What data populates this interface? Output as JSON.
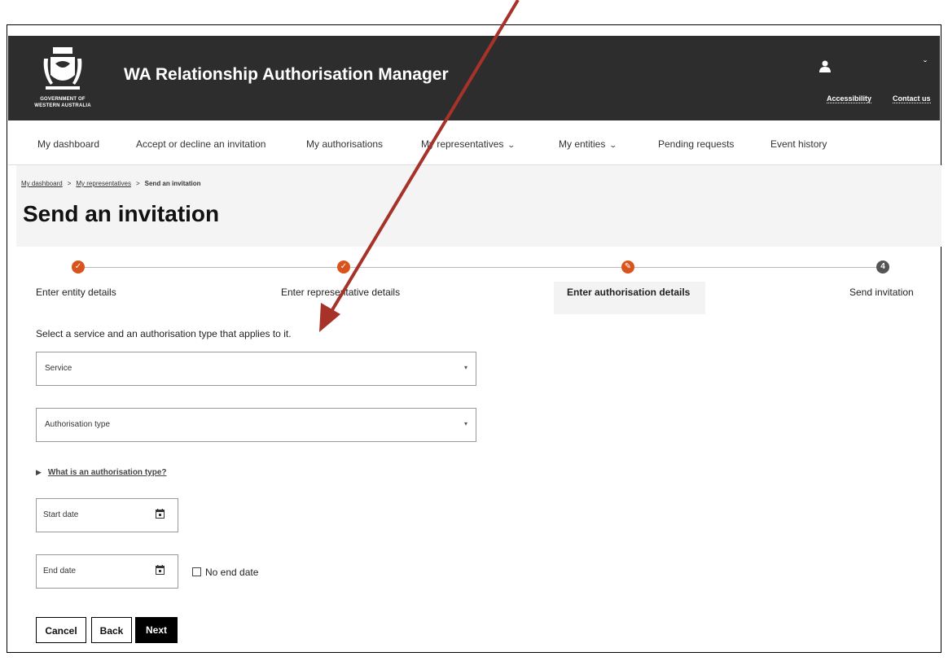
{
  "header": {
    "app_title": "WA Relationship Authorisation Manager",
    "gov_line1": "GOVERNMENT OF",
    "gov_line2": "WESTERN AUSTRALIA",
    "accessibility": "Accessibility",
    "contact": "Contact us",
    "user_icon": "user-icon",
    "menu_caret": "ˇ"
  },
  "nav": {
    "items": [
      {
        "label": "My dashboard"
      },
      {
        "label": "Accept or decline an invitation"
      },
      {
        "label": "My authorisations"
      },
      {
        "label": "My representatives",
        "dropdown": true
      },
      {
        "label": "My entities",
        "dropdown": true
      },
      {
        "label": "Pending requests"
      },
      {
        "label": "Event history"
      }
    ]
  },
  "breadcrumb": {
    "items": [
      "My dashboard",
      "My representatives",
      "Send an invitation"
    ],
    "separator": ">"
  },
  "page_title": "Send an invitation",
  "steps": [
    {
      "label": "Enter entity details",
      "state": "done"
    },
    {
      "label": "Enter representative details",
      "state": "done"
    },
    {
      "label": "Enter authorisation details",
      "state": "current"
    },
    {
      "label": "Send invitation",
      "state": "todo",
      "number": "4"
    }
  ],
  "form": {
    "intro": "Select a service and an authorisation type that applies to it.",
    "service_label": "Service",
    "authtype_label": "Authorisation type",
    "disclosure": "What is an authorisation type?",
    "start_date": "Start date",
    "end_date": "End date",
    "no_end_date": "No end date"
  },
  "buttons": {
    "cancel": "Cancel",
    "back": "Back",
    "next": "Next"
  },
  "colors": {
    "header_bg": "#2d2d2d",
    "step_accent": "#d9541c",
    "annotation_arrow": "#a6322a"
  }
}
